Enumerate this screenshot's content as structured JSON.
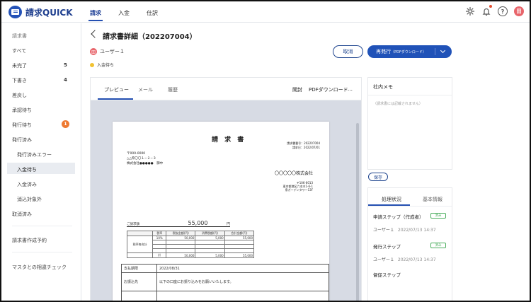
{
  "app": {
    "name": "請求QUICK",
    "nav": [
      "請求",
      "入金",
      "仕訳"
    ],
    "user_initial": "田"
  },
  "header_icons": [
    "settings-icon",
    "bell-icon",
    "help-icon",
    "avatar"
  ],
  "sidebar": {
    "heading": "請求書",
    "items": [
      {
        "label": "すべて"
      },
      {
        "label": "未完了",
        "count": "5"
      },
      {
        "label": "下書き",
        "count": "4"
      },
      {
        "label": "差戻し"
      },
      {
        "label": "承認待ち"
      },
      {
        "label": "発行待ち",
        "badge": "1"
      },
      {
        "label": "発行済み"
      },
      {
        "label": "発行済みエラー"
      },
      {
        "label": "入金待ち"
      },
      {
        "label": "入金済み"
      },
      {
        "label": "消込対象外"
      },
      {
        "label": "取消済み"
      }
    ],
    "reservation": "請求書作成予約",
    "master_check": "マスタとの相違チェック"
  },
  "page": {
    "title": "請求書詳細（202207004）",
    "user_initial": "田",
    "user": "ユーザー１",
    "status": "入金待ち",
    "cancel_button": "取消",
    "reissue_button": "再発行",
    "reissue_sub": "（PDFダウンロード）"
  },
  "preview": {
    "tabs": [
      "プレビュー",
      "メール",
      "履歴"
    ],
    "actions": [
      "開封",
      "PDFダウンロード",
      "…"
    ]
  },
  "invoice": {
    "title": "請 求 書",
    "number": "請求書番号：202207004",
    "date": "請求日：2022/07/01",
    "postal": "〒000-0000",
    "address": "△△県〇〇１−２−３",
    "customer": "株式会社●●●●●　御中",
    "issuer": "〇〇〇〇〇株式会社",
    "issuer_postal": "〒106-6013",
    "issuer_address1": "東京都港区六本木1-6-1",
    "issuer_address2": "泉ガーデンタワー13F",
    "amount_label": "ご請求額",
    "amount": "55,000",
    "amount_unit": "円",
    "table_headers": [
      "税率",
      "税抜金額(円)",
      "消費税額(円)",
      "合計金額(円)"
    ],
    "tax_label": "税率毎合計",
    "tax_row": [
      "10%",
      "50,000",
      "5,000",
      "55,000"
    ],
    "total_label": "計",
    "total_row": [
      "50,000",
      "5,000",
      "55,000"
    ],
    "due_label": "支払期限",
    "due_value": "2022/08/31",
    "payee_label": "お振込先",
    "payee_value": "以下の口座にお振り込みをお願いいたします。"
  },
  "memo": {
    "title": "社内メモ",
    "placeholder": "（請求書には記載されません）",
    "save_button": "保存"
  },
  "process": {
    "tabs": [
      "処理状況",
      "基本情報"
    ],
    "steps": [
      {
        "title": "申請ステップ（作成者）",
        "badge": "済み",
        "user": "ユーザー１",
        "date": "2022/07/13 14:37"
      },
      {
        "title": "発行ステップ",
        "badge": "済み",
        "user": "ユーザー１",
        "date": "2022/07/13 14:37"
      },
      {
        "title": "督促ステップ"
      }
    ]
  },
  "colors": {
    "primary": "#2052b8",
    "warning": "#ee7a32",
    "status": "#f1c232",
    "success": "#4cae5f"
  }
}
